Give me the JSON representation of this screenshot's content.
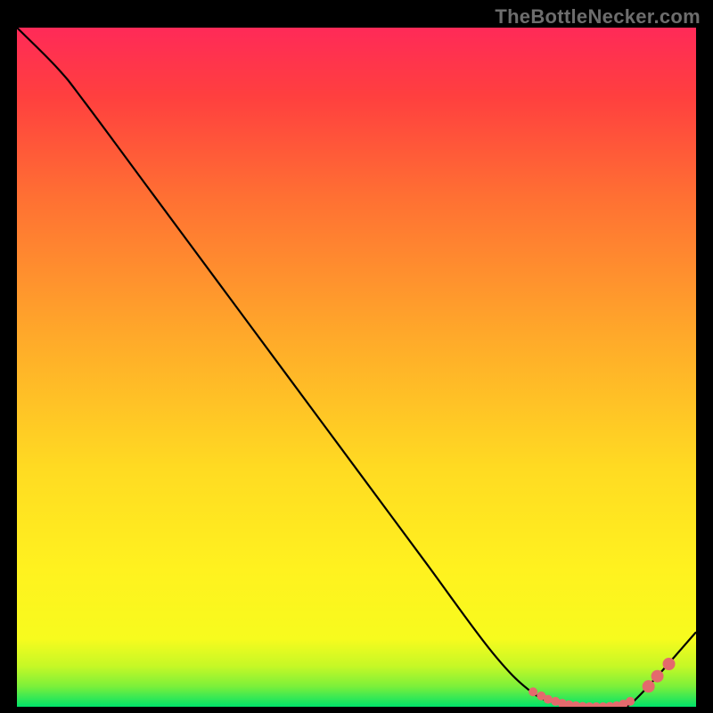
{
  "watermark": "TheBottleNecker.com",
  "chart_data": {
    "type": "line",
    "title": "",
    "xlabel": "",
    "ylabel": "",
    "xlim": [
      0,
      100
    ],
    "ylim": [
      0,
      100
    ],
    "gradient_stops": [
      {
        "offset": 0,
        "color": "#00e36a"
      },
      {
        "offset": 3,
        "color": "#7cf03a"
      },
      {
        "offset": 6,
        "color": "#c6f826"
      },
      {
        "offset": 10,
        "color": "#f7fb1e"
      },
      {
        "offset": 20,
        "color": "#fff21f"
      },
      {
        "offset": 35,
        "color": "#ffdb22"
      },
      {
        "offset": 55,
        "color": "#ffa82a"
      },
      {
        "offset": 75,
        "color": "#ff7033"
      },
      {
        "offset": 90,
        "color": "#ff3f3f"
      },
      {
        "offset": 100,
        "color": "#ff2a58"
      }
    ],
    "series": [
      {
        "name": "curve",
        "x": [
          0,
          6,
          10,
          20,
          30,
          40,
          50,
          60,
          70,
          76,
          80,
          84,
          88,
          91,
          100
        ],
        "y": [
          100,
          94,
          89,
          75.5,
          62,
          48.5,
          35,
          21.5,
          8,
          2,
          0.5,
          0,
          0,
          1,
          11
        ]
      }
    ],
    "markers": {
      "name": "dots",
      "color": "#e46a6d",
      "radius_small": 5,
      "radius_large": 7,
      "points": [
        {
          "x": 76.0,
          "y": 2.2,
          "r": "small"
        },
        {
          "x": 77.2,
          "y": 1.6,
          "r": "small"
        },
        {
          "x": 78.2,
          "y": 1.1,
          "r": "small"
        },
        {
          "x": 79.3,
          "y": 0.8,
          "r": "small"
        },
        {
          "x": 80.3,
          "y": 0.5,
          "r": "small"
        },
        {
          "x": 81.3,
          "y": 0.3,
          "r": "small"
        },
        {
          "x": 82.3,
          "y": 0.15,
          "r": "small"
        },
        {
          "x": 83.3,
          "y": 0.05,
          "r": "small"
        },
        {
          "x": 84.3,
          "y": 0.0,
          "r": "small"
        },
        {
          "x": 85.3,
          "y": 0.0,
          "r": "small"
        },
        {
          "x": 86.3,
          "y": 0.0,
          "r": "small"
        },
        {
          "x": 87.3,
          "y": 0.05,
          "r": "small"
        },
        {
          "x": 88.3,
          "y": 0.15,
          "r": "small"
        },
        {
          "x": 89.3,
          "y": 0.4,
          "r": "small"
        },
        {
          "x": 90.3,
          "y": 0.8,
          "r": "small"
        },
        {
          "x": 93.0,
          "y": 3.0,
          "r": "large"
        },
        {
          "x": 94.3,
          "y": 4.5,
          "r": "large"
        },
        {
          "x": 96.0,
          "y": 6.3,
          "r": "large"
        }
      ]
    }
  }
}
